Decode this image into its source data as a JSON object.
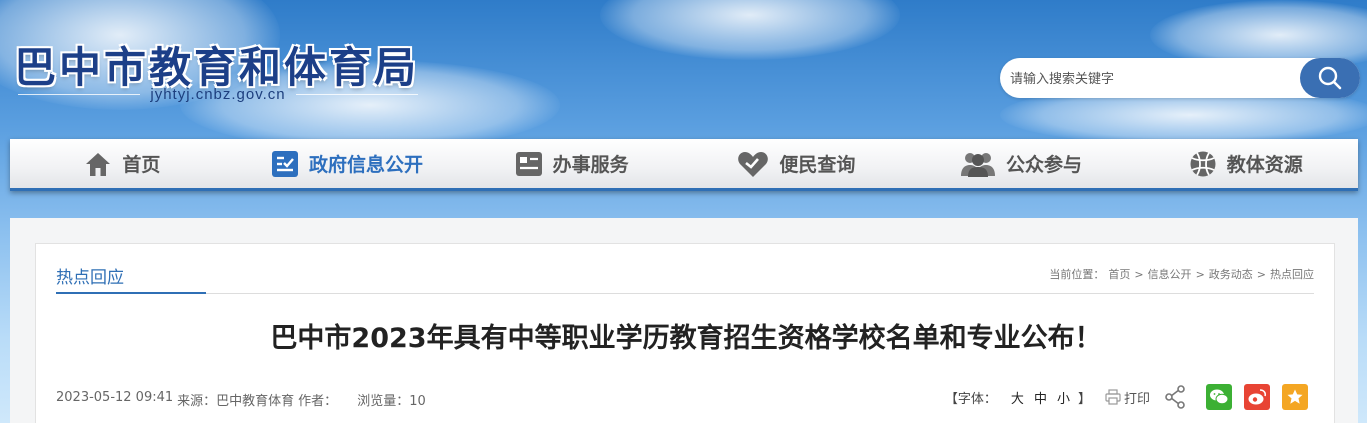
{
  "header": {
    "site_title": "巴中市教育和体育局",
    "site_domain": "jyhtyj.cnbz.gov.cn",
    "search_placeholder": "请输入搜索关键字"
  },
  "nav": {
    "items": [
      {
        "label": "首页",
        "icon": "home-icon"
      },
      {
        "label": "政府信息公开",
        "icon": "checklist-icon",
        "active": true
      },
      {
        "label": "办事服务",
        "icon": "service-icon"
      },
      {
        "label": "便民查询",
        "icon": "heart-query-icon"
      },
      {
        "label": "公众参与",
        "icon": "people-icon"
      },
      {
        "label": "教体资源",
        "icon": "basketball-icon"
      }
    ]
  },
  "article": {
    "section": "热点回应",
    "breadcrumb": {
      "prefix": "当前位置：",
      "items": [
        "首页",
        "信息公开",
        "政务动态",
        "热点回应"
      ],
      "separator": ">"
    },
    "title": "巴中市2023年具有中等职业学历教育招生资格学校名单和专业公布！",
    "meta": {
      "date": "2023-05-12 09:41",
      "source": "来源：巴中教育体育",
      "author": "作者：",
      "views": "浏览量：10"
    },
    "tools": {
      "font_label": "【字体：",
      "sizes": [
        "大",
        "中",
        "小"
      ],
      "font_close": "】",
      "print": "打印"
    }
  },
  "colors": {
    "accent": "#2f6fb5",
    "nav_active": "#2d6fbe",
    "wechat": "#3cb034",
    "weibo": "#e84434",
    "favorite": "#f4a623"
  }
}
